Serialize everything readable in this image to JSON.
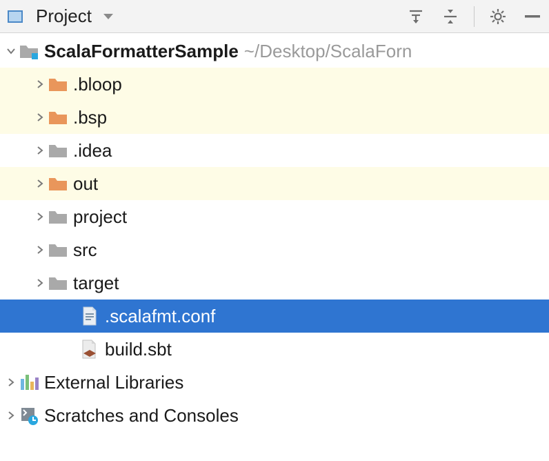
{
  "toolbar": {
    "title": "Project"
  },
  "tree": {
    "root": {
      "name": "ScalaFormatterSample",
      "path": "~/Desktop/ScalaForn"
    },
    "children": [
      {
        "name": ".bloop",
        "kind": "folder-excluded",
        "highlighted": true
      },
      {
        "name": ".bsp",
        "kind": "folder-excluded",
        "highlighted": true
      },
      {
        "name": ".idea",
        "kind": "folder",
        "highlighted": false
      },
      {
        "name": "out",
        "kind": "folder-excluded",
        "highlighted": true
      },
      {
        "name": "project",
        "kind": "folder",
        "highlighted": false
      },
      {
        "name": "src",
        "kind": "folder",
        "highlighted": false
      },
      {
        "name": "target",
        "kind": "folder",
        "highlighted": false
      }
    ],
    "files": [
      {
        "name": ".scalafmt.conf",
        "kind": "file-conf",
        "selected": true
      },
      {
        "name": "build.sbt",
        "kind": "file-sbt",
        "selected": false
      }
    ],
    "siblings": [
      {
        "name": "External Libraries",
        "kind": "libraries"
      },
      {
        "name": "Scratches and Consoles",
        "kind": "scratches"
      }
    ]
  }
}
